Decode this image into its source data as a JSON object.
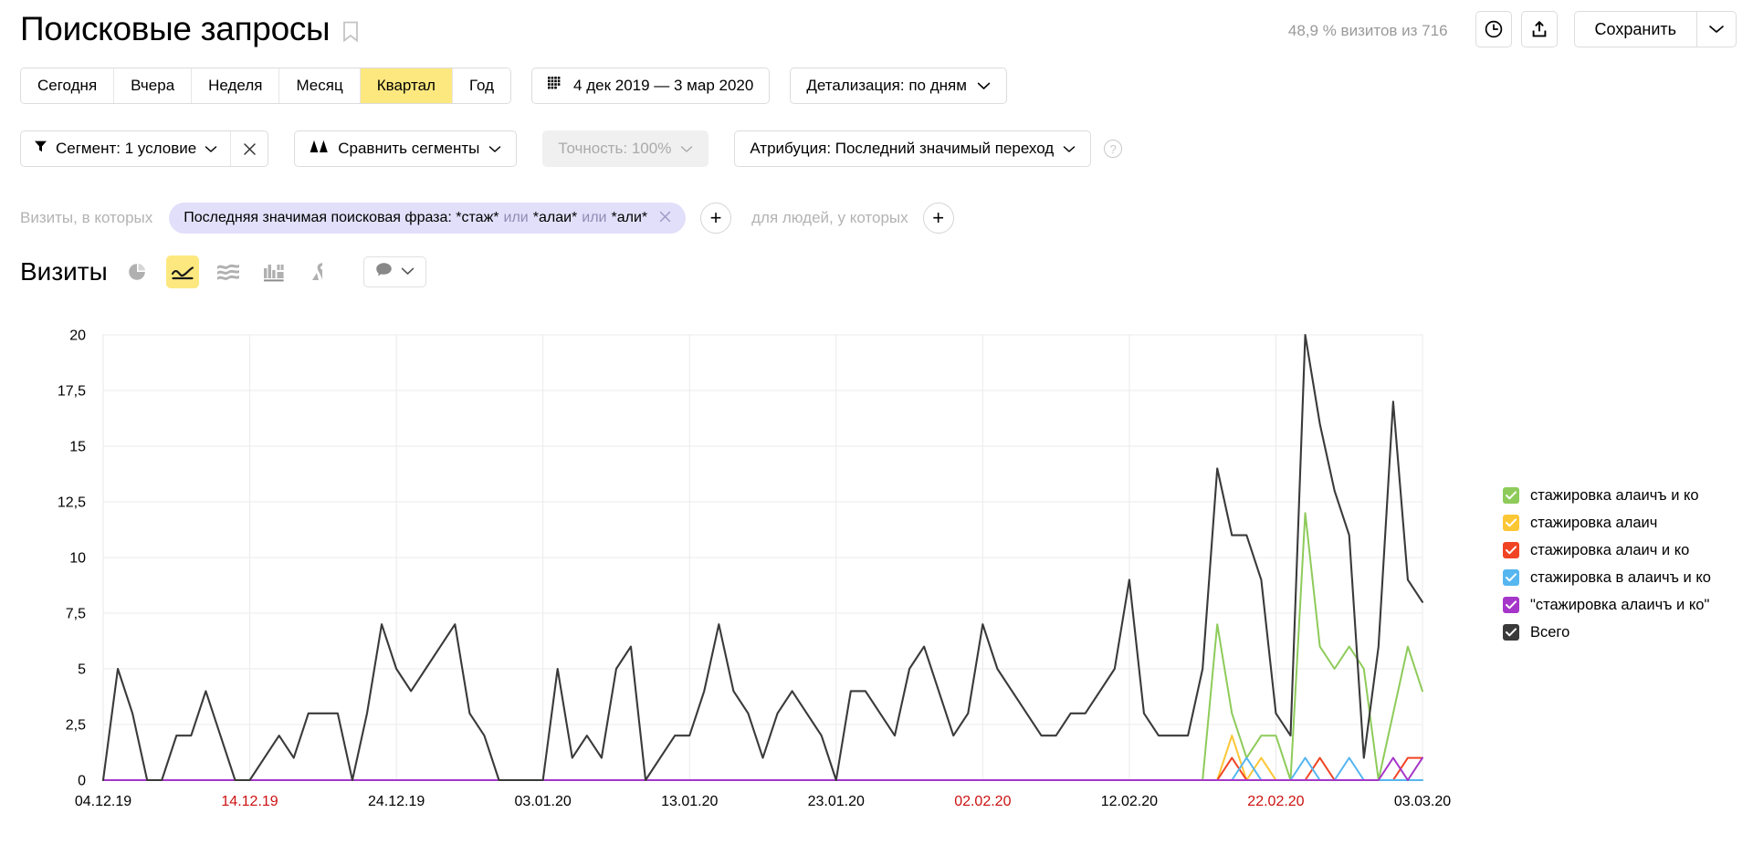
{
  "header": {
    "title": "Поисковые запросы",
    "bookmark_icon": "bookmark-icon",
    "visits_summary": "48,9 % визитов из 716",
    "history_icon": "clock-icon",
    "share_icon": "share-upload-icon",
    "save_label": "Сохранить",
    "save_caret_icon": "chevron-down-icon"
  },
  "period": {
    "tabs": [
      {
        "label": "Сегодня",
        "active": false
      },
      {
        "label": "Вчера",
        "active": false
      },
      {
        "label": "Неделя",
        "active": false
      },
      {
        "label": "Месяц",
        "active": false
      },
      {
        "label": "Квартал",
        "active": true
      },
      {
        "label": "Год",
        "active": false
      }
    ],
    "date_range": "4 дек 2019 — 3 мар 2020",
    "calendar_icon": "calendar-grid-icon",
    "detail_label": "Детализация: по дням",
    "detail_caret_icon": "chevron-down-icon"
  },
  "filters": {
    "segment_icon": "funnel-icon",
    "segment_label": "Сегмент: 1 условие",
    "segment_caret_icon": "chevron-down-icon",
    "segment_close_icon": "close-x-icon",
    "compare_icon": "compare-segments-icon",
    "compare_label": "Сравнить сегменты",
    "compare_caret_icon": "chevron-down-icon",
    "accuracy_label": "Точность: 100%",
    "accuracy_caret_icon": "chevron-down-icon",
    "attribution_label": "Атрибуция: Последний значимый переход",
    "attribution_caret_icon": "chevron-down-icon",
    "help_label": "?"
  },
  "condition": {
    "prefix_label": "Визиты, в которых",
    "chip_main": "Последняя значимая поисковая фраза: *стаж*",
    "chip_or1": "или",
    "chip_val2": "*алаи*",
    "chip_or2": "или",
    "chip_val3": "*али*",
    "chip_close_icon": "close-x-icon",
    "add_condition_label": "+",
    "people_label": "для людей, у которых",
    "add_people_label": "+"
  },
  "metric": {
    "name": "Визиты",
    "chart_types": [
      {
        "icon": "pie-chart-icon",
        "active": false
      },
      {
        "icon": "line-chart-icon",
        "active": true
      },
      {
        "icon": "area-stack-icon",
        "active": false
      },
      {
        "icon": "bar-chart-icon",
        "active": false
      },
      {
        "icon": "map-pin-icon",
        "active": false
      }
    ],
    "comment_icon": "comment-bubble-icon",
    "comment_caret_icon": "chevron-down-icon"
  },
  "legend": {
    "items": [
      {
        "label": "стажировка алаичъ и ко",
        "color": "#8ecb5a",
        "checked": true
      },
      {
        "label": "стажировка алаич",
        "color": "#fcc735",
        "checked": true
      },
      {
        "label": "стажировка алаич и ко",
        "color": "#f04422",
        "checked": true
      },
      {
        "label": "стажировка в алаичъ и ко",
        "color": "#56b6f0",
        "checked": true
      },
      {
        "label": "\"стажировка алаичъ и ко\"",
        "color": "#a536c9",
        "checked": true
      },
      {
        "label": "Всего",
        "color": "#3a3a3a",
        "checked": true
      }
    ]
  },
  "chart_data": {
    "type": "line",
    "title": "Визиты",
    "xlabel": "",
    "ylabel": "",
    "ylim": [
      0,
      20
    ],
    "yticks": [
      0,
      2.5,
      5,
      7.5,
      10,
      12.5,
      15,
      17.5,
      20
    ],
    "ytick_labels": [
      "0",
      "2,5",
      "5",
      "7,5",
      "10",
      "12,5",
      "15",
      "17,5",
      "20"
    ],
    "grid": true,
    "legend_position": "right",
    "x_tick_labels": [
      {
        "label": "04.12.19",
        "index": 0,
        "weekend": false
      },
      {
        "label": "14.12.19",
        "index": 10,
        "weekend": true
      },
      {
        "label": "24.12.19",
        "index": 20,
        "weekend": false
      },
      {
        "label": "03.01.20",
        "index": 30,
        "weekend": false
      },
      {
        "label": "13.01.20",
        "index": 40,
        "weekend": false
      },
      {
        "label": "23.01.20",
        "index": 50,
        "weekend": false
      },
      {
        "label": "02.02.20",
        "index": 60,
        "weekend": true
      },
      {
        "label": "12.02.20",
        "index": 70,
        "weekend": false
      },
      {
        "label": "22.02.20",
        "index": 80,
        "weekend": true
      },
      {
        "label": "03.03.20",
        "index": 90,
        "weekend": false
      }
    ],
    "x_count": 91,
    "series": [
      {
        "name": "Всего",
        "color": "#3a3a3a",
        "values": [
          0,
          5,
          3,
          0,
          0,
          2,
          2,
          4,
          2,
          0,
          0,
          1,
          2,
          1,
          3,
          3,
          3,
          0,
          3,
          7,
          5,
          4,
          5,
          6,
          7,
          3,
          2,
          0,
          0,
          0,
          0,
          5,
          1,
          2,
          1,
          5,
          6,
          0,
          1,
          2,
          2,
          4,
          7,
          4,
          3,
          1,
          3,
          4,
          3,
          2,
          0,
          4,
          4,
          3,
          2,
          5,
          6,
          4,
          2,
          3,
          7,
          5,
          4,
          3,
          2,
          2,
          3,
          3,
          4,
          5,
          9,
          3,
          2,
          2,
          2,
          5,
          14,
          11,
          11,
          9,
          3,
          2,
          20,
          16,
          13,
          11,
          1,
          6,
          17,
          9,
          8
        ]
      },
      {
        "name": "стажировка алаичъ и ко",
        "color": "#8ecb5a",
        "values": [
          0,
          0,
          0,
          0,
          0,
          0,
          0,
          0,
          0,
          0,
          0,
          0,
          0,
          0,
          0,
          0,
          0,
          0,
          0,
          0,
          0,
          0,
          0,
          0,
          0,
          0,
          0,
          0,
          0,
          0,
          0,
          0,
          0,
          0,
          0,
          0,
          0,
          0,
          0,
          0,
          0,
          0,
          0,
          0,
          0,
          0,
          0,
          0,
          0,
          0,
          0,
          0,
          0,
          0,
          0,
          0,
          0,
          0,
          0,
          0,
          0,
          0,
          0,
          0,
          0,
          0,
          0,
          0,
          0,
          0,
          0,
          0,
          0,
          0,
          0,
          0,
          7,
          3,
          1,
          2,
          2,
          0,
          12,
          6,
          5,
          6,
          5,
          0,
          3,
          6,
          4
        ]
      },
      {
        "name": "стажировка алаич",
        "color": "#fcc735",
        "values": [
          0,
          0,
          0,
          0,
          0,
          0,
          0,
          0,
          0,
          0,
          0,
          0,
          0,
          0,
          0,
          0,
          0,
          0,
          0,
          0,
          0,
          0,
          0,
          0,
          0,
          0,
          0,
          0,
          0,
          0,
          0,
          0,
          0,
          0,
          0,
          0,
          0,
          0,
          0,
          0,
          0,
          0,
          0,
          0,
          0,
          0,
          0,
          0,
          0,
          0,
          0,
          0,
          0,
          0,
          0,
          0,
          0,
          0,
          0,
          0,
          0,
          0,
          0,
          0,
          0,
          0,
          0,
          0,
          0,
          0,
          0,
          0,
          0,
          0,
          0,
          0,
          0,
          2,
          0,
          1,
          0,
          0,
          0,
          0,
          0,
          0,
          0,
          0,
          0,
          0,
          0
        ]
      },
      {
        "name": "стажировка алаич и ко",
        "color": "#f04422",
        "values": [
          0,
          0,
          0,
          0,
          0,
          0,
          0,
          0,
          0,
          0,
          0,
          0,
          0,
          0,
          0,
          0,
          0,
          0,
          0,
          0,
          0,
          0,
          0,
          0,
          0,
          0,
          0,
          0,
          0,
          0,
          0,
          0,
          0,
          0,
          0,
          0,
          0,
          0,
          0,
          0,
          0,
          0,
          0,
          0,
          0,
          0,
          0,
          0,
          0,
          0,
          0,
          0,
          0,
          0,
          0,
          0,
          0,
          0,
          0,
          0,
          0,
          0,
          0,
          0,
          0,
          0,
          0,
          0,
          0,
          0,
          0,
          0,
          0,
          0,
          0,
          0,
          0,
          1,
          0,
          0,
          0,
          0,
          0,
          1,
          0,
          0,
          0,
          0,
          0,
          1,
          1
        ]
      },
      {
        "name": "стажировка в алаичъ и ко",
        "color": "#56b6f0",
        "values": [
          0,
          0,
          0,
          0,
          0,
          0,
          0,
          0,
          0,
          0,
          0,
          0,
          0,
          0,
          0,
          0,
          0,
          0,
          0,
          0,
          0,
          0,
          0,
          0,
          0,
          0,
          0,
          0,
          0,
          0,
          0,
          0,
          0,
          0,
          0,
          0,
          0,
          0,
          0,
          0,
          0,
          0,
          0,
          0,
          0,
          0,
          0,
          0,
          0,
          0,
          0,
          0,
          0,
          0,
          0,
          0,
          0,
          0,
          0,
          0,
          0,
          0,
          0,
          0,
          0,
          0,
          0,
          0,
          0,
          0,
          0,
          0,
          0,
          0,
          0,
          0,
          0,
          0,
          1,
          0,
          0,
          0,
          1,
          0,
          0,
          1,
          0,
          0,
          0,
          0,
          0
        ]
      },
      {
        "name": "\"стажировка алаичъ и ко\"",
        "color": "#a536c9",
        "values": [
          0,
          0,
          0,
          0,
          0,
          0,
          0,
          0,
          0,
          0,
          0,
          0,
          0,
          0,
          0,
          0,
          0,
          0,
          0,
          0,
          0,
          0,
          0,
          0,
          0,
          0,
          0,
          0,
          0,
          0,
          0,
          0,
          0,
          0,
          0,
          0,
          0,
          0,
          0,
          0,
          0,
          0,
          0,
          0,
          0,
          0,
          0,
          0,
          0,
          0,
          0,
          0,
          0,
          0,
          0,
          0,
          0,
          0,
          0,
          0,
          0,
          0,
          0,
          0,
          0,
          0,
          0,
          0,
          0,
          0,
          0,
          0,
          0,
          0,
          0,
          0,
          0,
          0,
          0,
          0,
          0,
          0,
          0,
          0,
          0,
          0,
          0,
          0,
          1,
          0,
          1
        ]
      }
    ]
  }
}
